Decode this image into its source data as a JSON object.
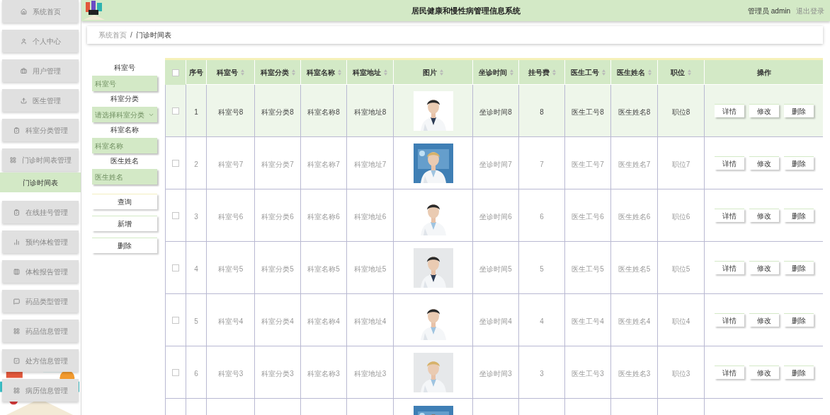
{
  "header": {
    "title": "居民健康和慢性病管理信息系统",
    "user": "管理员 admin",
    "logout": "退出登录"
  },
  "sidebar": {
    "items": [
      {
        "label": "系统首页",
        "selected": false
      },
      {
        "label": "个人中心",
        "selected": false
      },
      {
        "label": "用户管理",
        "selected": false
      },
      {
        "label": "医生管理",
        "selected": false
      },
      {
        "label": "科室分类管理",
        "selected": false
      },
      {
        "label": "门诊时间表管理",
        "selected": false,
        "children": [
          {
            "label": "门诊时间表",
            "selected": true
          }
        ]
      },
      {
        "label": "在线挂号管理",
        "selected": false
      },
      {
        "label": "预约体检管理",
        "selected": false
      },
      {
        "label": "体检报告管理",
        "selected": false
      },
      {
        "label": "药品类型管理",
        "selected": false
      },
      {
        "label": "药品信息管理",
        "selected": false
      },
      {
        "label": "处方信息管理",
        "selected": false
      },
      {
        "label": "病历信息管理",
        "selected": false
      }
    ]
  },
  "breadcrumb": {
    "items": [
      "系统首页",
      "门诊时间表"
    ],
    "separator": "/"
  },
  "search": {
    "fields": [
      {
        "label": "科室号",
        "placeholder": "科室号",
        "kind": "text"
      },
      {
        "label": "科室分类",
        "placeholder": "请选择科室分类",
        "kind": "select"
      },
      {
        "label": "科室名称",
        "placeholder": "科室名称",
        "kind": "text"
      },
      {
        "label": "医生姓名",
        "placeholder": "医生姓名",
        "kind": "text"
      }
    ],
    "buttons": [
      "查询",
      "新增",
      "删除"
    ]
  },
  "table": {
    "header_checkbox": {
      "checked": false
    },
    "columns": [
      {
        "label": "序号",
        "kind": "text",
        "sortable": false
      },
      {
        "label": "科室号",
        "kind": "text",
        "sortable": true
      },
      {
        "label": "科室分类",
        "kind": "text",
        "sortable": true
      },
      {
        "label": "科室名称",
        "kind": "text",
        "sortable": true
      },
      {
        "label": "科室地址",
        "kind": "text",
        "sortable": true
      },
      {
        "label": "图片",
        "kind": "picture",
        "sortable": true
      },
      {
        "label": "坐诊时间",
        "kind": "text",
        "sortable": true
      },
      {
        "label": "挂号费",
        "kind": "text",
        "sortable": true
      },
      {
        "label": "医生工号",
        "kind": "text",
        "sortable": true
      },
      {
        "label": "医生姓名",
        "kind": "text",
        "sortable": true
      },
      {
        "label": "职位",
        "kind": "text",
        "sortable": true
      },
      {
        "label": "操作",
        "kind": "actions",
        "sortable": false
      }
    ],
    "rows": [
      {
        "kind": "full",
        "checked": false,
        "highlighted": true,
        "cells": [
          "1",
          "科室号8",
          "科室分类8",
          "科室名称8",
          "科室地址8",
          "坐诊时间8",
          "8",
          "医生工号8",
          "医生姓名8",
          "职位8"
        ],
        "actions": [
          "详情",
          "修改",
          "删除"
        ]
      },
      {
        "kind": "full",
        "checked": false,
        "highlighted": false,
        "cells": [
          "2",
          "科室号7",
          "科室分类7",
          "科室名称7",
          "科室地址7",
          "坐诊时间7",
          "7",
          "医生工号7",
          "医生姓名7",
          "职位7"
        ],
        "actions": [
          "详情",
          "修改",
          "删除"
        ]
      },
      {
        "kind": "full",
        "checked": false,
        "highlighted": false,
        "cells": [
          "3",
          "科室号6",
          "科室分类6",
          "科室名称6",
          "科室地址6",
          "坐诊时间6",
          "6",
          "医生工号6",
          "医生姓名6",
          "职位6"
        ],
        "actions": [
          "详情",
          "修改",
          "删除"
        ]
      },
      {
        "kind": "full",
        "checked": false,
        "highlighted": false,
        "cells": [
          "4",
          "科室号5",
          "科室分类5",
          "科室名称5",
          "科室地址5",
          "坐诊时间5",
          "5",
          "医生工号5",
          "医生姓名5",
          "职位5"
        ],
        "actions": [
          "详情",
          "修改",
          "删除"
        ]
      },
      {
        "kind": "full",
        "checked": false,
        "highlighted": false,
        "cells": [
          "5",
          "科室号4",
          "科室分类4",
          "科室名称4",
          "科室地址4",
          "坐诊时间4",
          "4",
          "医生工号4",
          "医生姓名4",
          "职位4"
        ],
        "actions": [
          "详情",
          "修改",
          "删除"
        ]
      },
      {
        "kind": "full",
        "checked": false,
        "highlighted": false,
        "cells": [
          "6",
          "科室号3",
          "科室分类3",
          "科室名称3",
          "科室地址3",
          "坐诊时间3",
          "3",
          "医生工号3",
          "医生姓名3",
          "职位3"
        ],
        "actions": [
          "详情",
          "修改",
          "删除"
        ]
      },
      {
        "kind": "partial",
        "highlighted": false
      }
    ]
  }
}
